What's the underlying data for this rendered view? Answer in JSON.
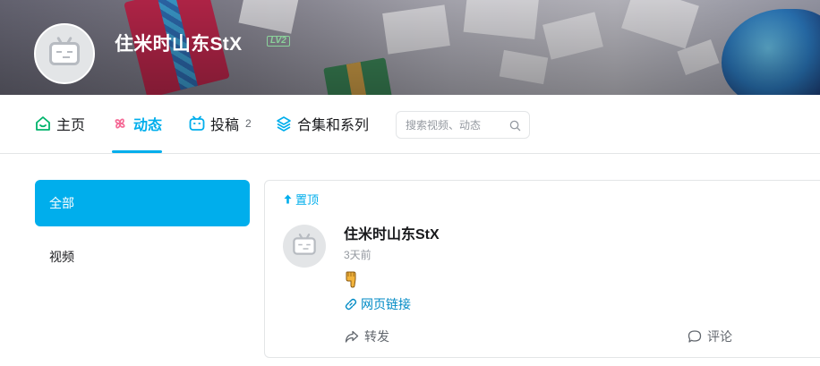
{
  "profile": {
    "username": "住米时山东StX",
    "level": "LV2"
  },
  "nav": {
    "tabs": [
      {
        "label": "主页",
        "icon": "home-icon"
      },
      {
        "label": "动态",
        "icon": "pinwheel-icon",
        "active": true
      },
      {
        "label": "投稿",
        "icon": "tv-icon",
        "count": "2"
      },
      {
        "label": "合集和系列",
        "icon": "layers-icon"
      }
    ],
    "search_placeholder": "搜索视频、动态"
  },
  "sidebar": {
    "items": [
      {
        "label": "全部",
        "active": true
      },
      {
        "label": "视频"
      }
    ]
  },
  "post": {
    "pinned_label": "置顶",
    "author": "住米时山东StX",
    "time": "3天前",
    "emoji_icon": "pointing-down-hand-icon",
    "link_label": "网页链接",
    "repost_label": "转发",
    "comment_label": "评论"
  },
  "colors": {
    "accent": "#00aeec",
    "link": "#008ac5",
    "level_badge": "#8bd29b"
  }
}
